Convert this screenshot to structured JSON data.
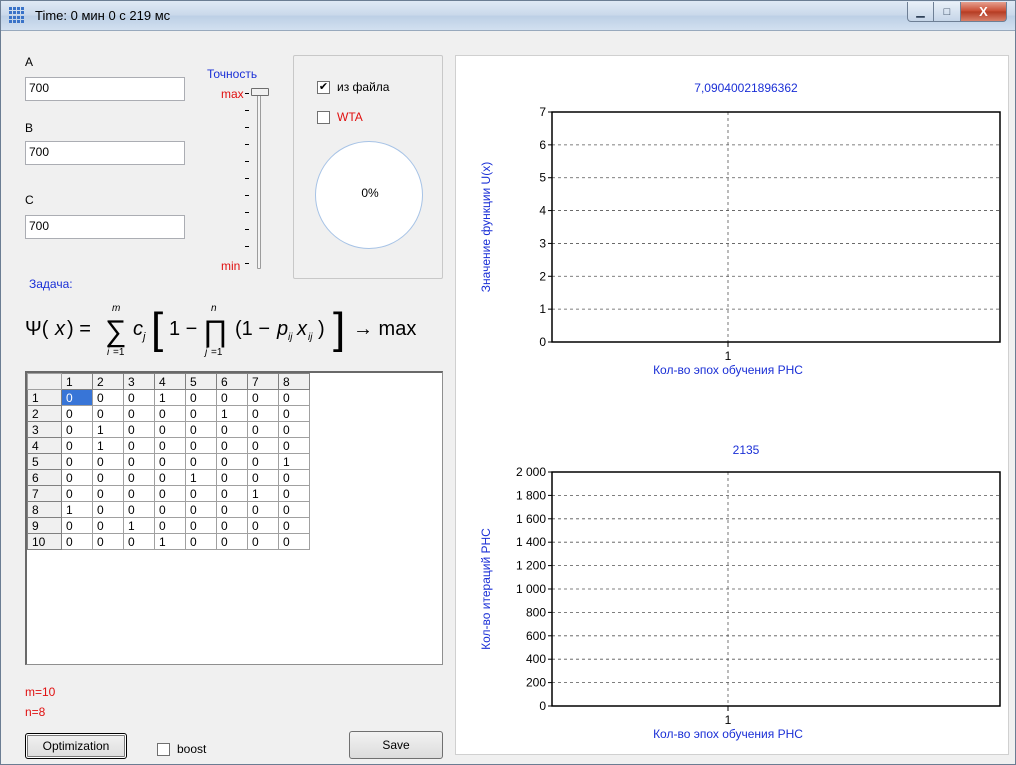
{
  "window": {
    "title": "Time: 0 мин 0 с 219 мс"
  },
  "inputs": {
    "a": {
      "label": "A",
      "value": "700"
    },
    "b": {
      "label": "B",
      "value": "700"
    },
    "c": {
      "label": "C",
      "value": "700"
    }
  },
  "precision": {
    "label": "Точность",
    "max_label": "max",
    "min_label": "min",
    "level": "max"
  },
  "options": {
    "from_file": {
      "label": "из файла",
      "checked": true
    },
    "wta": {
      "label": "WTA",
      "checked": false
    },
    "progress": "0%"
  },
  "task_label": "Задача:",
  "matrix": {
    "col_headers": [
      "1",
      "2",
      "3",
      "4",
      "5",
      "6",
      "7",
      "8"
    ],
    "row_headers": [
      "1",
      "2",
      "3",
      "4",
      "5",
      "6",
      "7",
      "8",
      "9",
      "10"
    ],
    "rows": [
      [
        "0",
        "0",
        "0",
        "1",
        "0",
        "0",
        "0",
        "0"
      ],
      [
        "0",
        "0",
        "0",
        "0",
        "0",
        "1",
        "0",
        "0"
      ],
      [
        "0",
        "1",
        "0",
        "0",
        "0",
        "0",
        "0",
        "0"
      ],
      [
        "0",
        "1",
        "0",
        "0",
        "0",
        "0",
        "0",
        "0"
      ],
      [
        "0",
        "0",
        "0",
        "0",
        "0",
        "0",
        "0",
        "1"
      ],
      [
        "0",
        "0",
        "0",
        "0",
        "1",
        "0",
        "0",
        "0"
      ],
      [
        "0",
        "0",
        "0",
        "0",
        "0",
        "0",
        "1",
        "0"
      ],
      [
        "1",
        "0",
        "0",
        "0",
        "0",
        "0",
        "0",
        "0"
      ],
      [
        "0",
        "0",
        "1",
        "0",
        "0",
        "0",
        "0",
        "0"
      ],
      [
        "0",
        "0",
        "0",
        "1",
        "0",
        "0",
        "0",
        "0"
      ]
    ]
  },
  "stats": {
    "m": "m=10",
    "n": "n=8"
  },
  "buttons": {
    "optimization": "Optimization",
    "boost": "boost",
    "save": "Save"
  },
  "colors": {
    "accent_blue": "#1a2fd6",
    "accent_red": "#e01010",
    "selection": "#3875d7"
  },
  "chart_data": [
    {
      "type": "line",
      "title": "7,09040021896362",
      "xlabel": "Кол-во эпох обучения РНС",
      "ylabel": "Значение функции U(x)",
      "x": [
        1
      ],
      "series": [
        {
          "values": []
        }
      ],
      "xticks": [
        "1"
      ],
      "yticks": [
        "0",
        "1",
        "2",
        "3",
        "4",
        "5",
        "6",
        "7"
      ],
      "ylim": [
        0,
        7
      ],
      "grid": true
    },
    {
      "type": "line",
      "title": "2135",
      "xlabel": "Кол-во эпох обучения РНС",
      "ylabel": "Кол-во итераций РНС",
      "x": [
        1
      ],
      "series": [
        {
          "values": []
        }
      ],
      "xticks": [
        "1"
      ],
      "yticks": [
        "0",
        "200",
        "400",
        "600",
        "800",
        "1 000",
        "1 200",
        "1 400",
        "1 600",
        "1 800",
        "2 000"
      ],
      "ylim": [
        0,
        2000
      ],
      "grid": true
    }
  ]
}
